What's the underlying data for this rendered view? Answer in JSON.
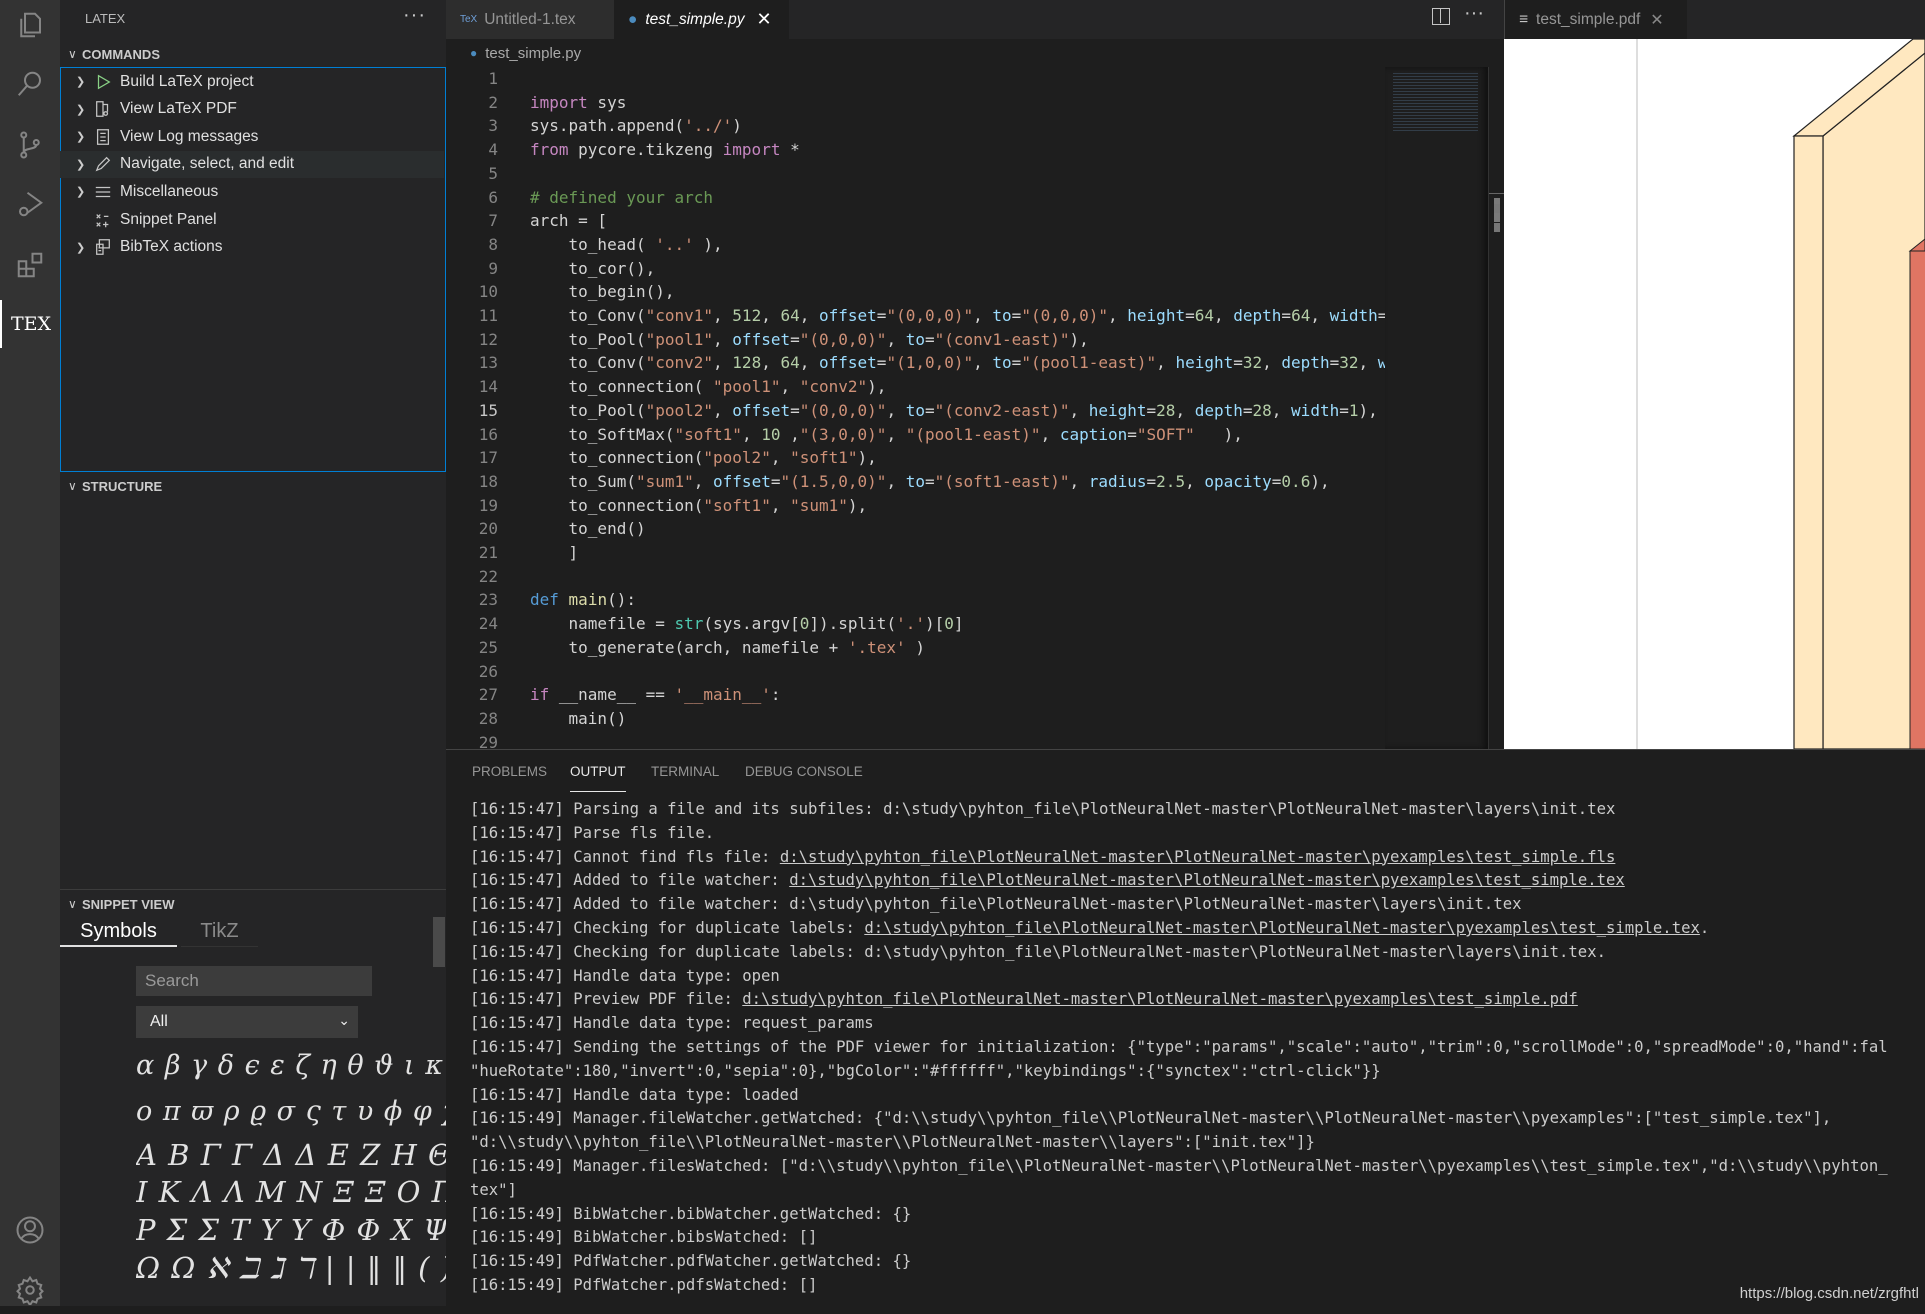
{
  "activity_bar": {
    "items": [
      "files-icon",
      "search-icon",
      "source-control-icon",
      "run-debug-icon",
      "extensions-icon",
      "tex-icon"
    ],
    "tex_label": "TEX",
    "bottom": [
      "account-icon",
      "gear-icon"
    ]
  },
  "sidebar": {
    "title": "LATEX",
    "more": "···",
    "commands_header": "COMMANDS",
    "commands": [
      {
        "label": "Build LaTeX project",
        "icon": "play-icon",
        "expandable": true
      },
      {
        "label": "View LaTeX PDF",
        "icon": "pdf-view-icon",
        "expandable": true
      },
      {
        "label": "View Log messages",
        "icon": "log-icon",
        "expandable": true
      },
      {
        "label": "Navigate, select, and edit",
        "icon": "pencil-icon",
        "expandable": true
      },
      {
        "label": "Miscellaneous",
        "icon": "list-icon",
        "expandable": true
      },
      {
        "label": "Snippet Panel",
        "icon": "snippet-icon",
        "expandable": false
      },
      {
        "label": "BibTeX actions",
        "icon": "bibtex-icon",
        "expandable": true
      }
    ],
    "structure_header": "STRUCTURE",
    "snippet_header": "SNIPPET VIEW",
    "snippet_tabs": [
      "Symbols",
      "TikZ"
    ],
    "search_placeholder": "Search",
    "filter_value": "All",
    "symbol_rows": [
      "α β γ δ ϵ ε ζ η θ ϑ ι κ λ μ ν ξ",
      "o π ϖ ρ ϱ σ ς τ υ ϕ φ χ ψ ω",
      "A B Γ Γ Δ Δ E Z H Θ Θ",
      "I K Λ Λ M N Ξ Ξ O Π Π",
      "P Σ Σ T Υ Υ Φ Φ X Ψ Ψ",
      "Ω Ω ℵ ℶ ℷ ℸ | | ‖ ‖ ( ) [ ] { } ⟨"
    ]
  },
  "editor": {
    "tabs": [
      {
        "label": "Untitled-1.tex",
        "icon": "tex-file-icon",
        "active": false
      },
      {
        "label": "test_simple.py",
        "icon": "python-icon",
        "active": true
      }
    ],
    "breadcrumb": "test_simple.py",
    "current_line": 15,
    "lines": [
      [],
      [
        [
          "import",
          "k"
        ],
        [
          " sys",
          "t"
        ]
      ],
      [
        [
          "sys.path.append(",
          "t"
        ],
        [
          "'../'",
          "s"
        ],
        [
          ")",
          "t"
        ]
      ],
      [
        [
          "from",
          "k"
        ],
        [
          " pycore.tikzeng ",
          "t"
        ],
        [
          "import",
          "k"
        ],
        [
          " *",
          "t"
        ]
      ],
      [],
      [
        [
          "# defined your arch",
          "c"
        ]
      ],
      [
        [
          "arch = [",
          "t"
        ]
      ],
      [
        [
          "    to_head( ",
          "t"
        ],
        [
          "'..'",
          "s"
        ],
        [
          " ),",
          "t"
        ]
      ],
      [
        [
          "    to_cor(),",
          "t"
        ]
      ],
      [
        [
          "    to_begin(),",
          "t"
        ]
      ],
      [
        [
          "    to_Conv(",
          "t"
        ],
        [
          "\"conv1\"",
          "s"
        ],
        [
          ", ",
          "t"
        ],
        [
          "512",
          "n"
        ],
        [
          ", ",
          "t"
        ],
        [
          "64",
          "n"
        ],
        [
          ", ",
          "t"
        ],
        [
          "offset",
          "p"
        ],
        [
          "=",
          "t"
        ],
        [
          "\"(0,0,0)\"",
          "s"
        ],
        [
          ", ",
          "t"
        ],
        [
          "to",
          "p"
        ],
        [
          "=",
          "t"
        ],
        [
          "\"(0,0,0)\"",
          "s"
        ],
        [
          ", ",
          "t"
        ],
        [
          "height",
          "p"
        ],
        [
          "=",
          "t"
        ],
        [
          "64",
          "n"
        ],
        [
          ", ",
          "t"
        ],
        [
          "depth",
          "p"
        ],
        [
          "=",
          "t"
        ],
        [
          "64",
          "n"
        ],
        [
          ", ",
          "t"
        ],
        [
          "width",
          "p"
        ],
        [
          "=",
          "t"
        ]
      ],
      [
        [
          "    to_Pool(",
          "t"
        ],
        [
          "\"pool1\"",
          "s"
        ],
        [
          ", ",
          "t"
        ],
        [
          "offset",
          "p"
        ],
        [
          "=",
          "t"
        ],
        [
          "\"(0,0,0)\"",
          "s"
        ],
        [
          ", ",
          "t"
        ],
        [
          "to",
          "p"
        ],
        [
          "=",
          "t"
        ],
        [
          "\"(conv1-east)\"",
          "s"
        ],
        [
          "),",
          "t"
        ]
      ],
      [
        [
          "    to_Conv(",
          "t"
        ],
        [
          "\"conv2\"",
          "s"
        ],
        [
          ", ",
          "t"
        ],
        [
          "128",
          "n"
        ],
        [
          ", ",
          "t"
        ],
        [
          "64",
          "n"
        ],
        [
          ", ",
          "t"
        ],
        [
          "offset",
          "p"
        ],
        [
          "=",
          "t"
        ],
        [
          "\"(1,0,0)\"",
          "s"
        ],
        [
          ", ",
          "t"
        ],
        [
          "to",
          "p"
        ],
        [
          "=",
          "t"
        ],
        [
          "\"(pool1-east)\"",
          "s"
        ],
        [
          ", ",
          "t"
        ],
        [
          "height",
          "p"
        ],
        [
          "=",
          "t"
        ],
        [
          "32",
          "n"
        ],
        [
          ", ",
          "t"
        ],
        [
          "depth",
          "p"
        ],
        [
          "=",
          "t"
        ],
        [
          "32",
          "n"
        ],
        [
          ", ",
          "t"
        ],
        [
          "w",
          "p"
        ]
      ],
      [
        [
          "    to_connection( ",
          "t"
        ],
        [
          "\"pool1\"",
          "s"
        ],
        [
          ", ",
          "t"
        ],
        [
          "\"conv2\"",
          "s"
        ],
        [
          "),",
          "t"
        ]
      ],
      [
        [
          "    to_Pool(",
          "t"
        ],
        [
          "\"pool2\"",
          "s"
        ],
        [
          ", ",
          "t"
        ],
        [
          "offset",
          "p"
        ],
        [
          "=",
          "t"
        ],
        [
          "\"(0,0,0)\"",
          "s"
        ],
        [
          ", ",
          "t"
        ],
        [
          "to",
          "p"
        ],
        [
          "=",
          "t"
        ],
        [
          "\"(conv2-east)\"",
          "s"
        ],
        [
          ", ",
          "t"
        ],
        [
          "height",
          "p"
        ],
        [
          "=",
          "t"
        ],
        [
          "28",
          "n"
        ],
        [
          ", ",
          "t"
        ],
        [
          "depth",
          "p"
        ],
        [
          "=",
          "t"
        ],
        [
          "28",
          "n"
        ],
        [
          ", ",
          "t"
        ],
        [
          "width",
          "p"
        ],
        [
          "=",
          "t"
        ],
        [
          "1",
          "n"
        ],
        [
          "),",
          "t"
        ]
      ],
      [
        [
          "    to_SoftMax(",
          "t"
        ],
        [
          "\"soft1\"",
          "s"
        ],
        [
          ", ",
          "t"
        ],
        [
          "10",
          "n"
        ],
        [
          " ,",
          "t"
        ],
        [
          "\"(3,0,0)\"",
          "s"
        ],
        [
          ", ",
          "t"
        ],
        [
          "\"(pool1-east)\"",
          "s"
        ],
        [
          ", ",
          "t"
        ],
        [
          "caption",
          "p"
        ],
        [
          "=",
          "t"
        ],
        [
          "\"SOFT\"",
          "s"
        ],
        [
          "   ),",
          "t"
        ]
      ],
      [
        [
          "    to_connection(",
          "t"
        ],
        [
          "\"pool2\"",
          "s"
        ],
        [
          ", ",
          "t"
        ],
        [
          "\"soft1\"",
          "s"
        ],
        [
          "),",
          "t"
        ]
      ],
      [
        [
          "    to_Sum(",
          "t"
        ],
        [
          "\"sum1\"",
          "s"
        ],
        [
          ", ",
          "t"
        ],
        [
          "offset",
          "p"
        ],
        [
          "=",
          "t"
        ],
        [
          "\"(1.5,0,0)\"",
          "s"
        ],
        [
          ", ",
          "t"
        ],
        [
          "to",
          "p"
        ],
        [
          "=",
          "t"
        ],
        [
          "\"(soft1-east)\"",
          "s"
        ],
        [
          ", ",
          "t"
        ],
        [
          "radius",
          "p"
        ],
        [
          "=",
          "t"
        ],
        [
          "2.5",
          "n"
        ],
        [
          ", ",
          "t"
        ],
        [
          "opacity",
          "p"
        ],
        [
          "=",
          "t"
        ],
        [
          "0.6",
          "n"
        ],
        [
          "),",
          "t"
        ]
      ],
      [
        [
          "    to_connection(",
          "t"
        ],
        [
          "\"soft1\"",
          "s"
        ],
        [
          ", ",
          "t"
        ],
        [
          "\"sum1\"",
          "s"
        ],
        [
          "),",
          "t"
        ]
      ],
      [
        [
          "    to_end()",
          "t"
        ]
      ],
      [
        [
          "    ]",
          "t"
        ]
      ],
      [],
      [
        [
          "def",
          "d"
        ],
        [
          " ",
          "t"
        ],
        [
          "main",
          "f"
        ],
        [
          "():",
          "t"
        ]
      ],
      [
        [
          "    namefile = ",
          "t"
        ],
        [
          "str",
          "b"
        ],
        [
          "(sys.argv[",
          "t"
        ],
        [
          "0",
          "n"
        ],
        [
          "]).split(",
          "t"
        ],
        [
          "'.'",
          "s"
        ],
        [
          ")[",
          "t"
        ],
        [
          "0",
          "n"
        ],
        [
          "]",
          "t"
        ]
      ],
      [
        [
          "    to_generate(arch, namefile + ",
          "t"
        ],
        [
          "'.tex'",
          "s"
        ],
        [
          " )",
          "t"
        ]
      ],
      [],
      [
        [
          "if",
          "k"
        ],
        [
          " __name__ == ",
          "t"
        ],
        [
          "'__main__'",
          "s"
        ],
        [
          ":",
          "t"
        ]
      ],
      [
        [
          "    main()",
          "t"
        ]
      ],
      []
    ]
  },
  "pdf_viewer": {
    "tab_label": "test_simple.pdf",
    "colors": {
      "slab": "#ffe8c0",
      "red_block": "#e07563"
    }
  },
  "panel": {
    "tabs": [
      "PROBLEMS",
      "OUTPUT",
      "TERMINAL",
      "DEBUG CONSOLE"
    ],
    "active_tab": "OUTPUT",
    "output_lines": [
      [
        [
          "[16:15:47] Parsing a file and its subfiles: d:\\study\\pyhton_file\\PlotNeuralNet-master\\PlotNeuralNet-master\\layers\\init.tex",
          0
        ]
      ],
      [
        [
          "[16:15:47] Parse fls file.",
          0
        ]
      ],
      [
        [
          "[16:15:47] Cannot find fls file: ",
          0
        ],
        [
          "d:\\study\\pyhton_file\\PlotNeuralNet-master\\PlotNeuralNet-master\\pyexamples\\test_simple.fls",
          1
        ]
      ],
      [
        [
          "[16:15:47] Added to file watcher: ",
          0
        ],
        [
          "d:\\study\\pyhton_file\\PlotNeuralNet-master\\PlotNeuralNet-master\\pyexamples\\test_simple.tex",
          1
        ]
      ],
      [
        [
          "[16:15:47] Added to file watcher: d:\\study\\pyhton_file\\PlotNeuralNet-master\\PlotNeuralNet-master\\layers\\init.tex",
          0
        ]
      ],
      [
        [
          "[16:15:47] Checking for duplicate labels: ",
          0
        ],
        [
          "d:\\study\\pyhton_file\\PlotNeuralNet-master\\PlotNeuralNet-master\\pyexamples\\test_simple.tex",
          1
        ],
        [
          ".",
          0
        ]
      ],
      [
        [
          "[16:15:47] Checking for duplicate labels: d:\\study\\pyhton_file\\PlotNeuralNet-master\\PlotNeuralNet-master\\layers\\init.tex.",
          0
        ]
      ],
      [
        [
          "[16:15:47] Handle data type: open",
          0
        ]
      ],
      [
        [
          "[16:15:47] Preview PDF file: ",
          0
        ],
        [
          "d:\\study\\pyhton_file\\PlotNeuralNet-master\\PlotNeuralNet-master\\pyexamples\\test_simple.pdf",
          1
        ]
      ],
      [
        [
          "[16:15:47] Handle data type: request_params",
          0
        ]
      ],
      [
        [
          "[16:15:47] Sending the settings of the PDF viewer for initialization: {\"type\":\"params\",\"scale\":\"auto\",\"trim\":0,\"scrollMode\":0,\"spreadMode\":0,\"hand\":fal",
          0
        ]
      ],
      [
        [
          "\"hueRotate\":180,\"invert\":0,\"sepia\":0},\"bgColor\":\"#ffffff\",\"keybindings\":{\"synctex\":\"ctrl-click\"}}",
          0
        ]
      ],
      [
        [
          "[16:15:47] Handle data type: loaded",
          0
        ]
      ],
      [
        [
          "[16:15:49] Manager.fileWatcher.getWatched: {\"d:\\\\study\\\\pyhton_file\\\\PlotNeuralNet-master\\\\PlotNeuralNet-master\\\\pyexamples\":[\"test_simple.tex\"],",
          0
        ]
      ],
      [
        [
          "\"d:\\\\study\\\\pyhton_file\\\\PlotNeuralNet-master\\\\PlotNeuralNet-master\\\\layers\":[\"init.tex\"]}",
          0
        ]
      ],
      [
        [
          "[16:15:49] Manager.filesWatched: [\"d:\\\\study\\\\pyhton_file\\\\PlotNeuralNet-master\\\\PlotNeuralNet-master\\\\pyexamples\\\\test_simple.tex\",\"d:\\\\study\\\\pyhton_",
          0
        ]
      ],
      [
        [
          "tex\"]",
          0
        ]
      ],
      [
        [
          "[16:15:49] BibWatcher.bibWatcher.getWatched: {}",
          0
        ]
      ],
      [
        [
          "[16:15:49] BibWatcher.bibsWatched: []",
          0
        ]
      ],
      [
        [
          "[16:15:49] PdfWatcher.pdfWatcher.getWatched: {}",
          0
        ]
      ],
      [
        [
          "[16:15:49] PdfWatcher.pdfsWatched: []",
          0
        ]
      ]
    ]
  },
  "watermark": "https://blog.csdn.net/zrgfhtl"
}
